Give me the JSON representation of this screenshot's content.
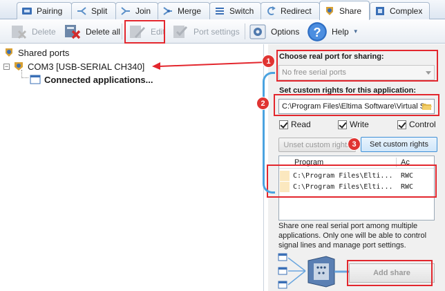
{
  "tabs": [
    {
      "label": "Pairing",
      "icon": "pairing-icon"
    },
    {
      "label": "Split",
      "icon": "split-icon"
    },
    {
      "label": "Join",
      "icon": "join-icon"
    },
    {
      "label": "Merge",
      "icon": "merge-icon"
    },
    {
      "label": "Switch",
      "icon": "switch-icon"
    },
    {
      "label": "Redirect",
      "icon": "redirect-icon"
    },
    {
      "label": "Share",
      "icon": "share-icon",
      "active": true
    },
    {
      "label": "Complex",
      "icon": "complex-icon"
    }
  ],
  "toolbar": {
    "delete_label": "Delete",
    "delete_all_label": "Delete all",
    "edit_label": "Edit",
    "port_settings_label": "Port settings",
    "options_label": "Options",
    "help_label": "Help"
  },
  "tree": {
    "root_label": "Shared ports",
    "port_label": "COM3 [USB-SERIAL CH340]",
    "child_label": "Connected applications..."
  },
  "panel": {
    "choose_port_label": "Choose real port for sharing:",
    "port_select_value": "No free serial ports",
    "custom_rights_label": "Set custom rights for this application:",
    "app_path_value": "C:\\Program Files\\Eltima Software\\Virtual S",
    "read_label": "Read",
    "write_label": "Write",
    "control_label": "Control",
    "unset_rights_label": "Unset custom rights",
    "set_rights_label": "Set custom rights",
    "list_header_program": "Program",
    "list_header_access": "Ac",
    "list_rows": [
      {
        "program": "C:\\Program Files\\Elti...",
        "access": "RWC"
      },
      {
        "program": "C:\\Program Files\\Elti...",
        "access": "RWC"
      }
    ],
    "description": "Share one real serial port among multiple applications. Only one will be able to control signal lines and manage port settings.",
    "add_share_label": "Add share"
  },
  "badges": [
    "1",
    "2",
    "3"
  ],
  "colors": {
    "annotation_red": "#e3262d",
    "annotation_blue": "#4aa3e0",
    "accent": "#3d8fd6"
  }
}
